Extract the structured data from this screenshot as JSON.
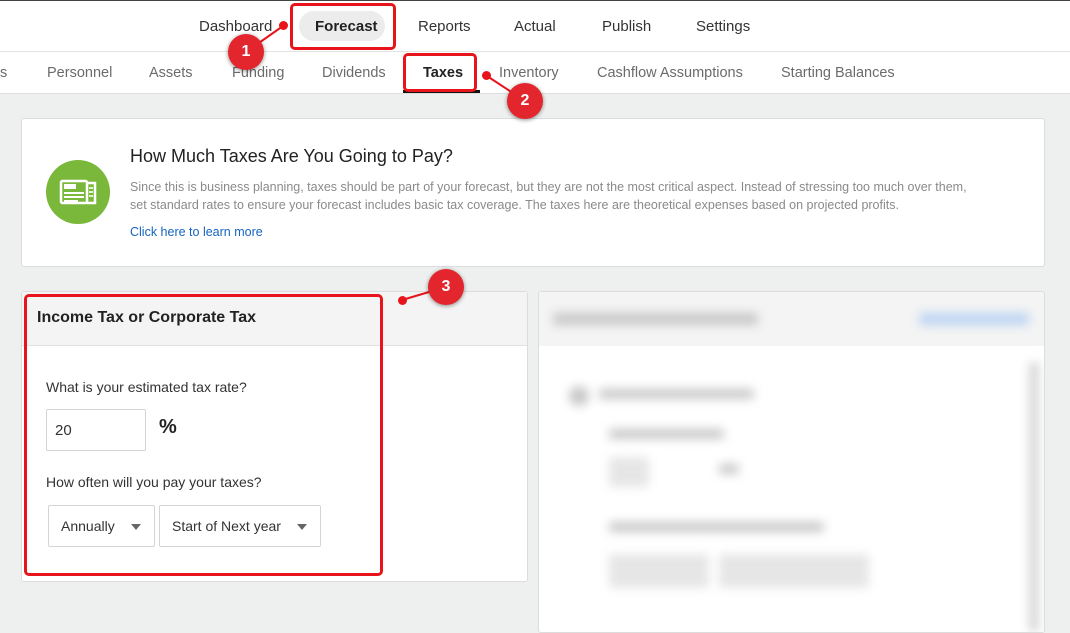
{
  "top_nav": {
    "items": [
      "Dashboard",
      "Forecast",
      "Reports",
      "Actual",
      "Publish",
      "Settings"
    ],
    "active": "Forecast"
  },
  "sub_nav": {
    "items": [
      "s",
      "Personnel",
      "Assets",
      "Funding",
      "Dividends",
      "Taxes",
      "Inventory",
      "Cashflow Assumptions",
      "Starting Balances"
    ],
    "active": "Taxes"
  },
  "info_card": {
    "icon": "tax-receipt-icon",
    "title": "How Much Taxes Are You Going to Pay?",
    "description_line1": "Since this is business planning, taxes should be part of your forecast, but they are not the most critical aspect. Instead of stressing too much over them,",
    "description_line2": "set standard rates to ensure your forecast includes basic tax coverage. The taxes here are theoretical expenses based on projected profits.",
    "link": "Click here to learn more"
  },
  "income_tax_card": {
    "title": "Income Tax or Corporate Tax",
    "rate_question": "What is your estimated tax rate?",
    "rate_value": "20",
    "rate_unit": "%",
    "frequency_question": "How often will you pay your taxes?",
    "frequency_value": "Annually",
    "timing_value": "Start of Next year"
  },
  "annotations": [
    "1",
    "2",
    "3"
  ],
  "colors": {
    "annotation_red": "#e8141b",
    "icon_green": "#7ab83b",
    "link_blue": "#1565c0"
  }
}
